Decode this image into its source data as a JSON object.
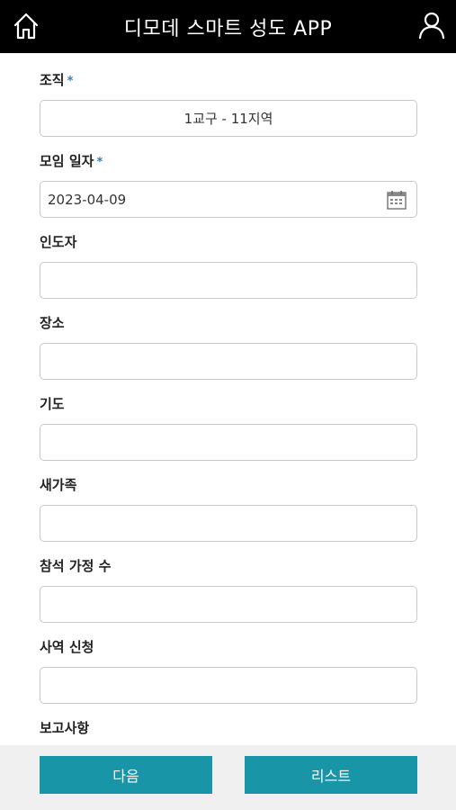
{
  "header": {
    "title": "디모데 스마트 성도 APP",
    "left_icon": "home-icon",
    "right_icon": "user-icon"
  },
  "form": {
    "organization": {
      "label": "조직",
      "required_mark": "*",
      "value": "1교구 - 11지역"
    },
    "meeting_date": {
      "label": "모임 일자",
      "required_mark": "*",
      "value": "2023-04-09",
      "icon": "calendar-icon"
    },
    "leader": {
      "label": "인도자",
      "value": ""
    },
    "place": {
      "label": "장소",
      "value": ""
    },
    "prayer": {
      "label": "기도",
      "value": ""
    },
    "new_family": {
      "label": "새가족",
      "value": ""
    },
    "attending_households": {
      "label": "참석 가정 수",
      "value": ""
    },
    "ministry_request": {
      "label": "사역 신청",
      "value": ""
    },
    "report": {
      "label": "보고사항"
    }
  },
  "footer": {
    "next_label": "다음",
    "list_label": "리스트"
  },
  "colors": {
    "header_bg": "#000000",
    "button_bg": "#1896a8",
    "footer_bg": "#f0f0f0",
    "required_mark": "#3a7ea8"
  }
}
